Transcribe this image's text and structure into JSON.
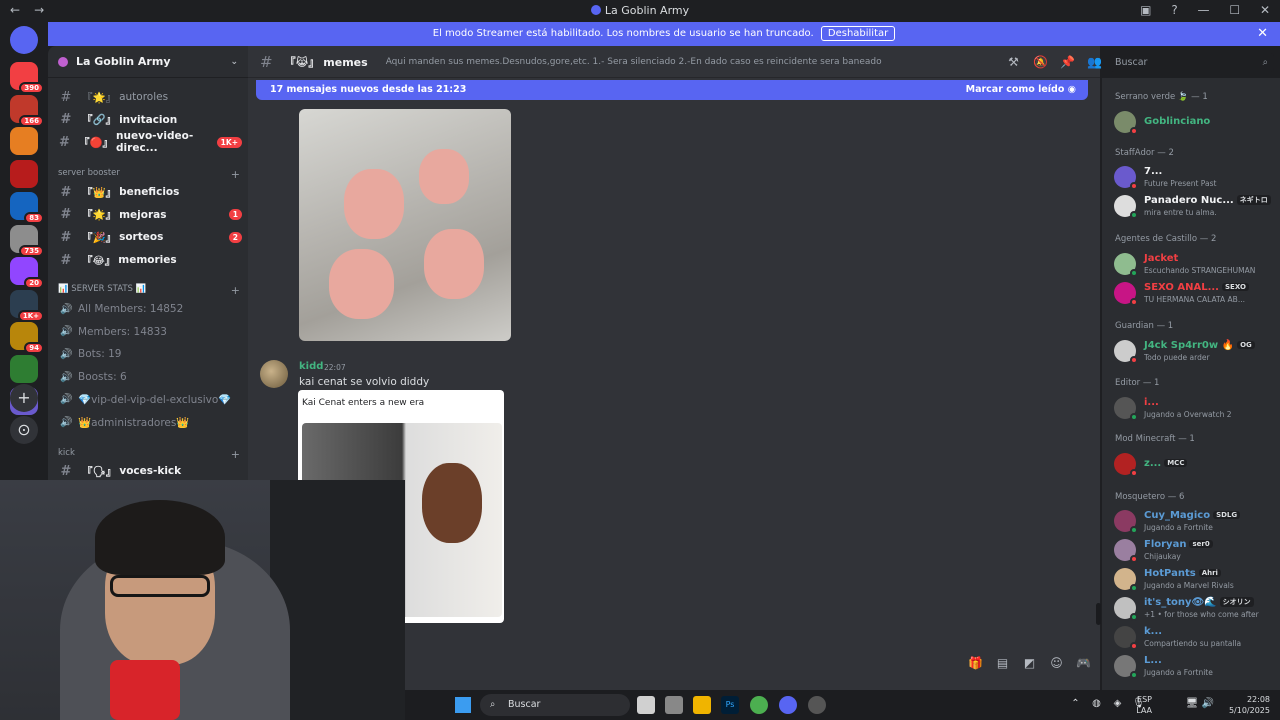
{
  "window": {
    "title": "La Goblin Army"
  },
  "banner": {
    "text": "El modo Streamer está habilitado. Los nombres de usuario se han truncado.",
    "button": "Deshabilitar"
  },
  "guilds": [
    {
      "color": "#f23f43",
      "badge": "390"
    },
    {
      "color": "#c0392b",
      "badge": "166"
    },
    {
      "color": "#e67e22",
      "badge": ""
    },
    {
      "color": "#b71c1c",
      "badge": ""
    },
    {
      "color": "#1565c0",
      "badge": "83"
    },
    {
      "color": "#8d8d8d",
      "badge": "735"
    },
    {
      "color": "#9146ff",
      "badge": "20"
    },
    {
      "color": "#2c3e50",
      "badge": "1K+"
    },
    {
      "color": "#b8860b",
      "badge": "94"
    },
    {
      "color": "#2e7d32",
      "badge": ""
    },
    {
      "color": "#6a5acd",
      "badge": ""
    }
  ],
  "server": {
    "name": "La Goblin Army"
  },
  "channels_top": [
    {
      "prefix": "『🌟』",
      "name": "autoroles",
      "badge": "",
      "bright": false
    },
    {
      "prefix": "『🔗』",
      "name": "invitacion",
      "badge": "",
      "bright": true
    },
    {
      "prefix": "『🔴』",
      "name": "nuevo-video-direc...",
      "badge": "1K+",
      "bright": true
    }
  ],
  "cat_booster": "server booster",
  "channels_booster": [
    {
      "prefix": "『👑』",
      "name": "beneficios",
      "badge": "",
      "bright": true
    },
    {
      "prefix": "『🌟』",
      "name": "mejoras",
      "badge": "1",
      "bright": true
    },
    {
      "prefix": "『🎉』",
      "name": "sorteos",
      "badge": "2",
      "bright": true
    },
    {
      "prefix": "『😂』",
      "name": "memories",
      "badge": "",
      "bright": true
    }
  ],
  "cat_stats": "📊 SERVER STATS 📊",
  "voice": [
    "All Members: 14852",
    "Members: 14833",
    "Bots: 19",
    "Boosts: 6",
    "💎vip-del-vip-del-exclusivo💎",
    "👑administradores👑"
  ],
  "cat_kick": "kick",
  "channel_kick": {
    "prefix": "『🗣』",
    "name": "voces-kick"
  },
  "chat": {
    "channel": "memes",
    "channel_prefix": "『😹』",
    "topic": "Aqui manden sus memes.Desnudos,gore,etc. 1.- Sera silenciado 2.-En dado caso es reincidente sera baneado",
    "search_placeholder": "Buscar",
    "new_messages": "17 mensajes nuevos desde las 21:23",
    "mark_read": "Marcar como leído",
    "message": {
      "author": "kidd",
      "time": "22:07",
      "text": "kai cenat se volvio diddy"
    },
    "card_title": "Kai Cenat enters a new era"
  },
  "members": {
    "groups": [
      {
        "title": "Serrano verde 🍃 — 1",
        "members": [
          {
            "name": "Goblinciano",
            "color": "#43b581",
            "activity": "",
            "tag": "",
            "avatar": "#7a8b6a",
            "status": "#f23f43"
          }
        ]
      },
      {
        "title": "StaffAdor — 2",
        "members": [
          {
            "name": "7...",
            "color": "#f2f3f5",
            "activity": "Future Present Past",
            "tag": "",
            "avatar": "#6a5acd",
            "status": "#f23f43"
          },
          {
            "name": "Panadero Nuc...",
            "color": "#f2f3f5",
            "activity": "mira entre tu alma.",
            "tag": "ネギトロ",
            "avatar": "#dddddd",
            "status": "#23a55a"
          }
        ]
      },
      {
        "title": "Agentes de Castillo — 2",
        "members": [
          {
            "name": "Jacket",
            "color": "#f23f43",
            "activity": "Escuchando STRANGEHUMAN",
            "tag": "",
            "avatar": "#8fbc8f",
            "status": "#23a55a"
          },
          {
            "name": "SEXO ANAL...",
            "color": "#f23f43",
            "activity": "TU HERMANA CALATA AB...",
            "tag": "SEXO",
            "avatar": "#c71585",
            "status": "#f23f43"
          }
        ]
      },
      {
        "title": "Guardian — 1",
        "members": [
          {
            "name": "J4ck Sp4rr0w 🔥",
            "color": "#43b581",
            "activity": "Todo puede arder",
            "tag": "OG",
            "avatar": "#cccccc",
            "status": "#f23f43"
          }
        ]
      },
      {
        "title": "Editor — 1",
        "members": [
          {
            "name": "i...",
            "color": "#f23f43",
            "activity": "Jugando a Overwatch 2",
            "tag": "",
            "avatar": "#555555",
            "status": "#23a55a"
          }
        ]
      },
      {
        "title": "Mod Minecraft — 1",
        "members": [
          {
            "name": "z...",
            "color": "#43b581",
            "activity": "",
            "tag": "MCC",
            "avatar": "#b22222",
            "status": "#f23f43"
          }
        ]
      },
      {
        "title": "Mosquetero — 6",
        "members": [
          {
            "name": "Cuy_Magico",
            "color": "#5b9bd5",
            "activity": "Jugando a Fortnite",
            "tag": "SDLG",
            "avatar": "#8b3a62",
            "status": "#23a55a"
          },
          {
            "name": "Floryan",
            "color": "#5b9bd5",
            "activity": "Chijaukay",
            "tag": "ser0",
            "avatar": "#9a7fa0",
            "status": "#f23f43"
          },
          {
            "name": "HotPants",
            "color": "#5b9bd5",
            "activity": "Jugando a Marvel Rivals",
            "tag": "Ahri",
            "avatar": "#d2b48c",
            "status": "#23a55a"
          },
          {
            "name": "it's_tony👁🌊",
            "color": "#5b9bd5",
            "activity": "+1 • for those who come after",
            "tag": "シオリン",
            "avatar": "#c0c0c0",
            "status": "#23a55a"
          },
          {
            "name": "k...",
            "color": "#5b9bd5",
            "activity": "Compartiendo su pantalla",
            "tag": "",
            "avatar": "#444444",
            "status": "#f23f43"
          },
          {
            "name": "L...",
            "color": "#5b9bd5",
            "activity": "Jugando a Fortnite",
            "tag": "",
            "avatar": "#777777",
            "status": "#23a55a"
          }
        ]
      }
    ]
  },
  "taskbar": {
    "search": "Buscar",
    "lang": "ESP",
    "layout": "LAA",
    "time": "22:08",
    "date": "5/10/2025"
  }
}
